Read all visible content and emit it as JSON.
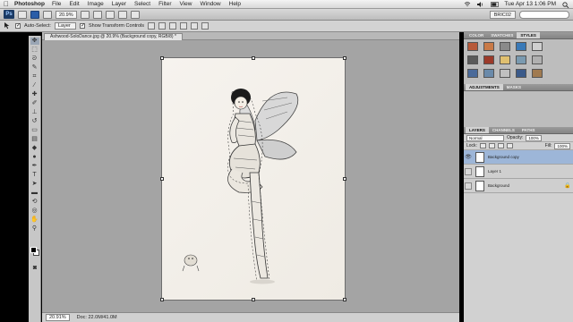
{
  "menubar": {
    "app_name": "Photoshop",
    "items": [
      "File",
      "Edit",
      "Image",
      "Layer",
      "Select",
      "Filter",
      "View",
      "Window",
      "Help"
    ],
    "clock": "Tue Apr 13  1:06 PM"
  },
  "appbar": {
    "badge": "Ps",
    "zoom": "20.9%",
    "workspace": "BRIC02"
  },
  "options": {
    "auto_select_label": "Auto-Select:",
    "auto_select_value": "Layer",
    "show_transform_label": "Show Transform Controls"
  },
  "document": {
    "tab_title": "Ashwood-SoloDance.jpg @ 20.9% (Background copy, RGB/8) *"
  },
  "status": {
    "zoom": "20.91%",
    "doc_size": "Doc: 22.0M/41.0M"
  },
  "panels": {
    "top_tabs": [
      "COLOR",
      "SWATCHES",
      "STYLES"
    ],
    "adj_tabs": [
      "ADJUSTMENTS",
      "MASKS"
    ],
    "layer_tabs": [
      "LAYERS",
      "CHANNELS",
      "PATHS"
    ],
    "blend_mode": "Normal",
    "opacity_label": "Opacity:",
    "opacity_value": "100%",
    "lock_label": "Lock:",
    "fill_label": "Fill:",
    "fill_value": "100%",
    "layers": [
      {
        "name": "Background copy",
        "selected": true
      },
      {
        "name": "Layer 1",
        "selected": false
      },
      {
        "name": "Background",
        "selected": false
      }
    ]
  },
  "colors": {
    "style_swatches": [
      "#b85a3a",
      "#c97a47",
      "#8a8a8a",
      "#3a7ab8",
      "#d0d0d0",
      "#5a5a5a",
      "#9c3a2a",
      "#e0c070",
      "#7a9ab0",
      "#b0b0b0",
      "#4a6a9a",
      "#6a8aaa",
      "#c0c0c0",
      "#3a5a8a",
      "#a07a50"
    ]
  }
}
